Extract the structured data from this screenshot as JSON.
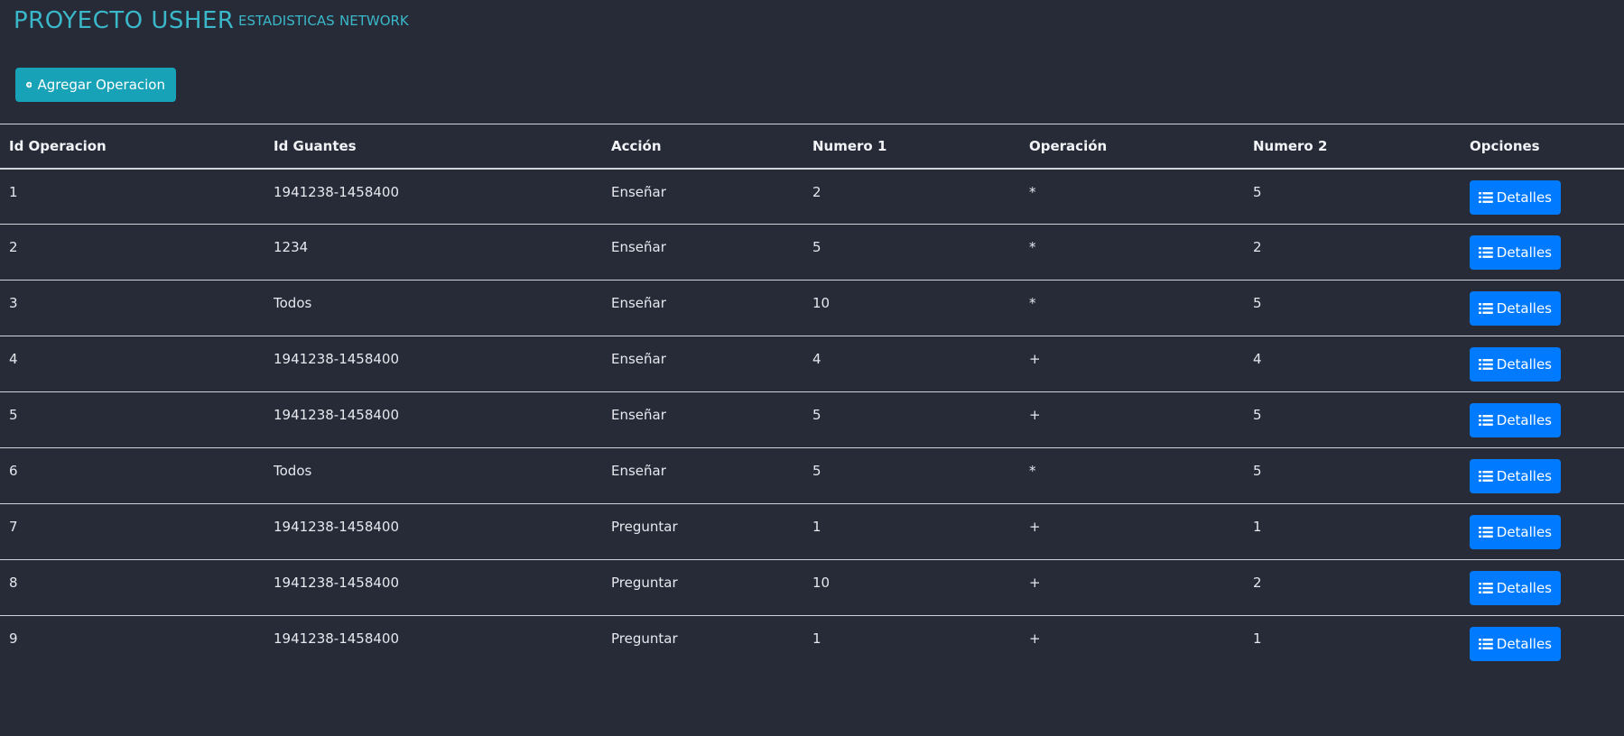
{
  "navbar": {
    "brand": "PROYECTO USHER",
    "links": [
      "ESTADISTICAS",
      "NETWORK"
    ]
  },
  "actions": {
    "add_label": "Agregar Operacion"
  },
  "table": {
    "headers": [
      "Id Operacion",
      "Id Guantes",
      "Acción",
      "Numero 1",
      "Operación",
      "Numero 2",
      "Opciones"
    ],
    "details_label": "Detalles",
    "rows": [
      [
        "1",
        "1941238-1458400",
        "Enseñar",
        "2",
        "*",
        "5"
      ],
      [
        "2",
        "1234",
        "Enseñar",
        "5",
        "*",
        "2"
      ],
      [
        "3",
        "Todos",
        "Enseñar",
        "10",
        "*",
        "5"
      ],
      [
        "4",
        "1941238-1458400",
        "Enseñar",
        "4",
        "+",
        "4"
      ],
      [
        "5",
        "1941238-1458400",
        "Enseñar",
        "5",
        "+",
        "5"
      ],
      [
        "6",
        "Todos",
        "Enseñar",
        "5",
        "*",
        "5"
      ],
      [
        "7",
        "1941238-1458400",
        "Preguntar",
        "1",
        "+",
        "1"
      ],
      [
        "8",
        "1941238-1458400",
        "Preguntar",
        "10",
        "+",
        "2"
      ],
      [
        "9",
        "1941238-1458400",
        "Preguntar",
        "1",
        "+",
        "1"
      ]
    ]
  },
  "colors": {
    "background": "#272b38",
    "brand": "#3ab8c9",
    "add_button": "#17a2b8",
    "details_button": "#007bff"
  },
  "icons": {
    "add": "plus-circle-icon",
    "details": "list-icon"
  }
}
